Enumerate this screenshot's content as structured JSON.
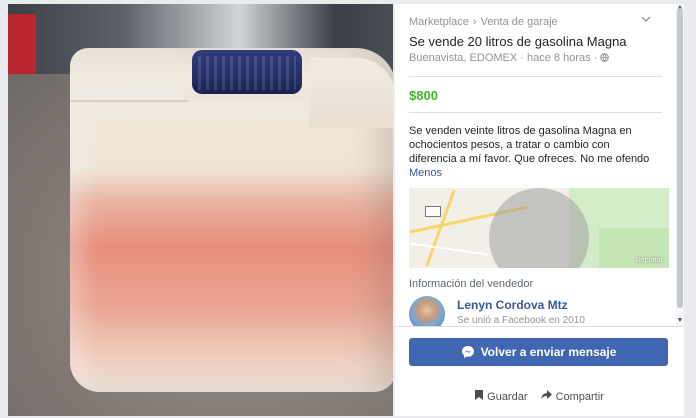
{
  "listing": {
    "breadcrumb": [
      "Marketplace",
      "Venta de garaje"
    ],
    "title": "Se vende 20 litros de gasolina Magna",
    "location_line": "Buenavista, EDOMEX · hace 8 horas ·",
    "price": "$800",
    "description": "Se venden veinte litros de gasolina Magna en ochocientos pesos, a tratar o cambio con diferencia a mí favor. Que ofreces. No me ofendo",
    "less_link": "Menos",
    "map_credit": "Reportar"
  },
  "seller": {
    "heading": "Información del vendedor",
    "name": "Lenyn Cordova Mtz",
    "since": "Se unió a Facebook en 2010"
  },
  "actions": {
    "message_button": "Volver a enviar mensaje",
    "save": "Guardar",
    "share": "Compartir"
  },
  "icons": {
    "messenger": "messenger-icon",
    "bookmark": "bookmark-icon",
    "share": "share-arrow-icon",
    "globe": "globe-icon",
    "chevron": "chevron-down-icon"
  },
  "colors": {
    "price_green": "#42b72a",
    "button_blue": "#4267b2",
    "link_blue": "#385898"
  }
}
